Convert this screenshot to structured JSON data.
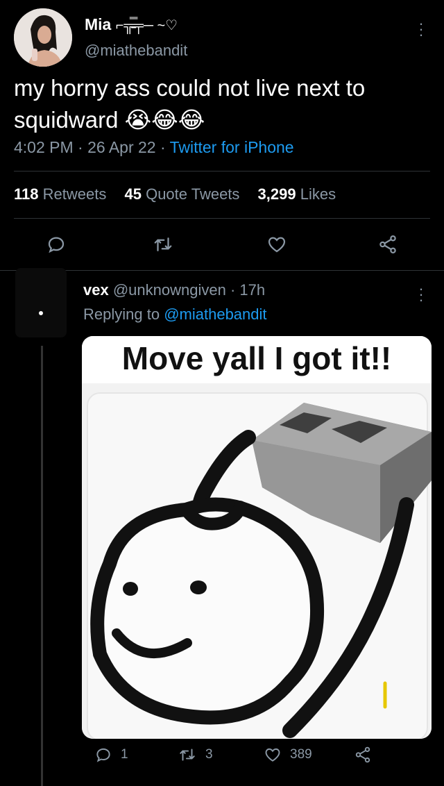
{
  "tweet": {
    "display_name": "Mia",
    "name_decoration": "⌐╦̵̵̿╤─ ~♡",
    "handle": "@miathebandit",
    "text": "my horny ass could not live next to squidward 😭😂😂",
    "time": "4:02 PM",
    "date": "26 Apr 22",
    "source": "Twitter for iPhone",
    "retweets_count": "118",
    "retweets_label": "Retweets",
    "quotes_count": "45",
    "quotes_label": "Quote Tweets",
    "likes_count": "3,299",
    "likes_label": "Likes"
  },
  "reply": {
    "display_name": "vex",
    "handle": "@unknowngiven",
    "time": "17h",
    "replying_label": "Replying to",
    "replying_handle": "@miathebandit",
    "media_caption": "Move yall I got it!!",
    "reply_count": "1",
    "retweet_count": "3",
    "like_count": "389"
  },
  "icons": [
    "reply-icon",
    "retweet-icon",
    "like-icon",
    "share-icon",
    "more-icon"
  ],
  "colors": {
    "accent": "#1d9bf0",
    "muted": "#8b98a5",
    "background": "#000000"
  }
}
